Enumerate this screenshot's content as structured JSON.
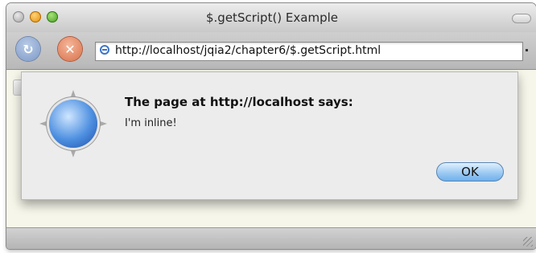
{
  "window": {
    "title": "$.getScript() Example"
  },
  "toolbar": {
    "url": "http://localhost/jqia2/chapter6/$.getScript.html",
    "reload_icon": "reload-icon",
    "stop_icon": "stop-icon"
  },
  "dialog": {
    "title": "The page at http://localhost says:",
    "message": "I'm inline!",
    "ok_label": "OK",
    "icon": "safari-compass-icon"
  },
  "colors": {
    "ok_button": "#9ecaf2",
    "stop_button": "#d8714a",
    "reload_button": "#7d99c8"
  }
}
